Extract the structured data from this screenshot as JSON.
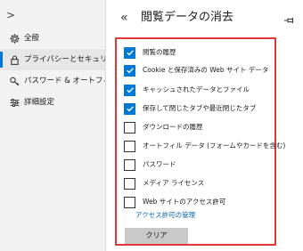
{
  "nav": {
    "expand_glyph": ">",
    "items": [
      {
        "label": "全般",
        "icon": "gear-icon",
        "active": false
      },
      {
        "label": "プライバシーとセキュリティ",
        "icon": "lock-icon",
        "active": true
      },
      {
        "label": "パスワード & オートフィル",
        "icon": "key-icon",
        "active": false
      },
      {
        "label": "詳細設定",
        "icon": "sliders-icon",
        "active": false
      }
    ]
  },
  "panel": {
    "back_glyph": "«",
    "title": "閲覧データの消去",
    "pin_icon": "pin-icon",
    "items": [
      {
        "label": "閲覧の履歴",
        "checked": true
      },
      {
        "label": "Cookie と保存済みの Web サイト データ",
        "checked": true
      },
      {
        "label": "キャッシュされたデータとファイル",
        "checked": true
      },
      {
        "label": "保存して閉じたタブや最近閉じたタブ",
        "checked": true
      },
      {
        "label": "ダウンロードの履歴",
        "checked": false
      },
      {
        "label": "オートフィル データ (フォームやカードを含む)",
        "checked": false
      },
      {
        "label": "パスワード",
        "checked": false
      },
      {
        "label": "メディア ライセンス",
        "checked": false
      },
      {
        "label": "Web サイトのアクセス許可",
        "checked": false
      }
    ],
    "manage_permissions_link": "アクセス許可の管理",
    "clear_button": "クリア"
  },
  "colors": {
    "accent": "#0078d7",
    "highlight_border": "#e23636",
    "link": "#0067b8",
    "nav_bg": "#f2f2f2",
    "button_bg": "#c8c8c8"
  }
}
